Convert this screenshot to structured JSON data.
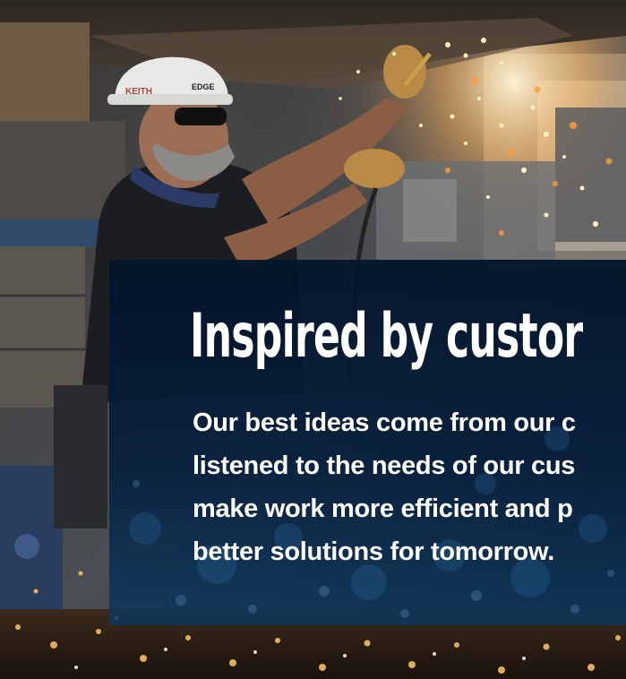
{
  "hero": {
    "headline": "Inspired by custor",
    "body_lines": [
      "Our best ideas come from our c",
      "listened to the needs of our cus",
      "make work more efficient and p",
      "better solutions for tomorrow."
    ]
  },
  "photo": {
    "hardhat_text_left": "KEITH",
    "hardhat_text_right": "EDGE"
  },
  "colors": {
    "panel_navy": "#04172f",
    "panel_blue": "#0a3a66",
    "spark_orange": "#ffb347",
    "spark_white": "#fff4d6"
  }
}
